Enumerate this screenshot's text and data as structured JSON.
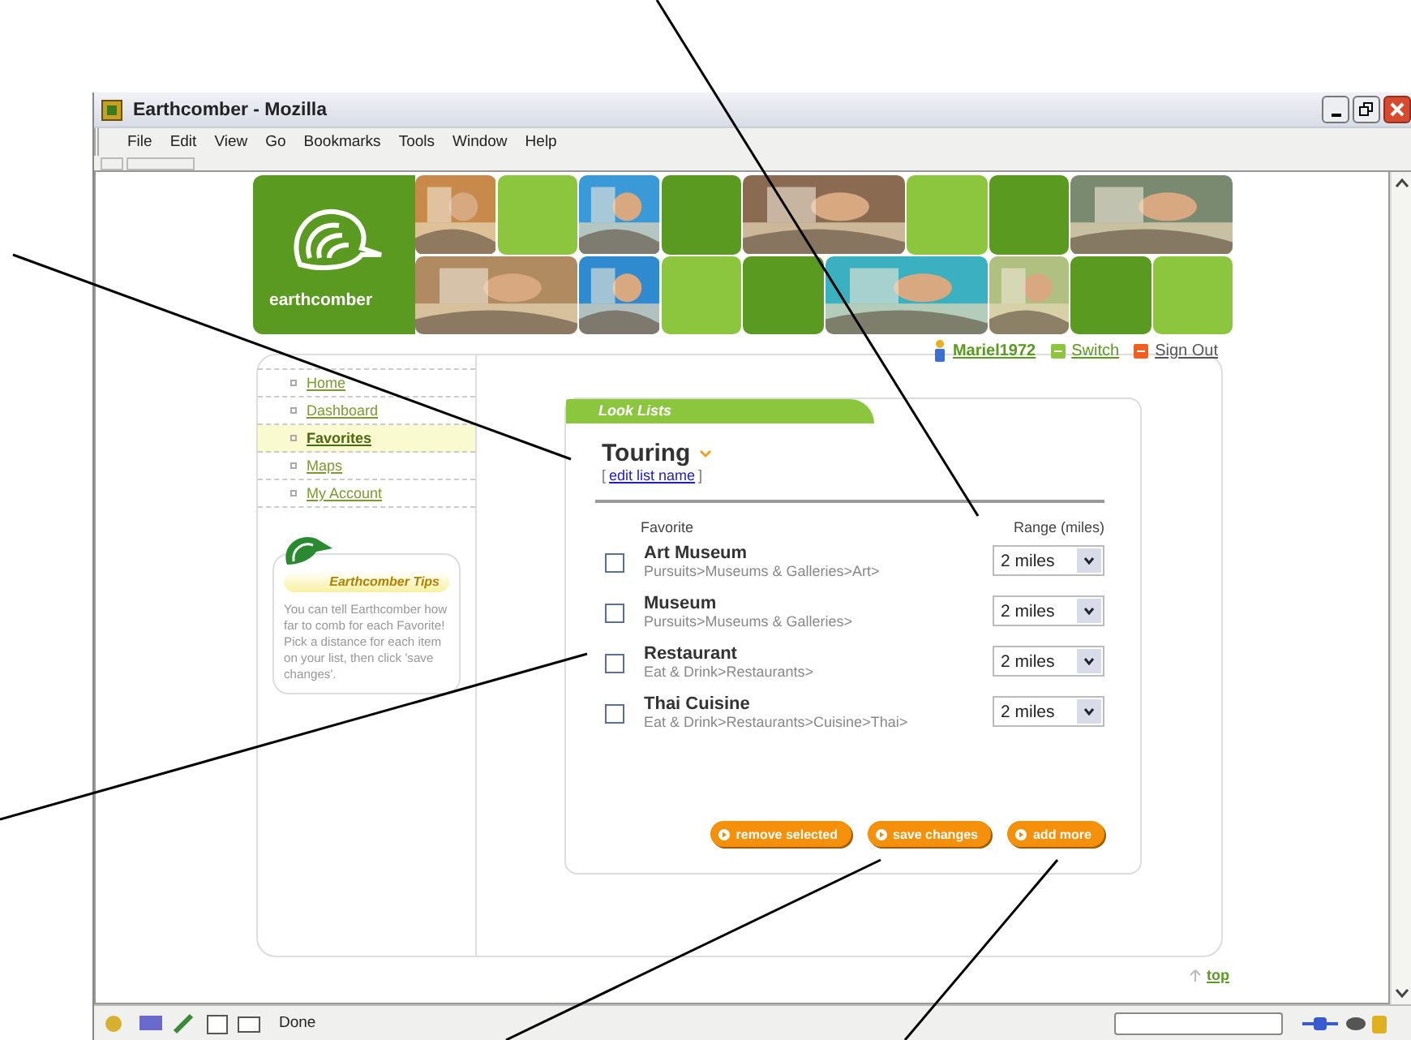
{
  "window": {
    "title": "Earthcomber - Mozilla"
  },
  "menu": [
    "File",
    "Edit",
    "View",
    "Go",
    "Bookmarks",
    "Tools",
    "Window",
    "Help"
  ],
  "logo": {
    "text": "earthcomber"
  },
  "user": {
    "name": "Mariel1972",
    "switch": "Switch",
    "sign_out": "Sign Out"
  },
  "nav": [
    {
      "label": "Home",
      "selected": false
    },
    {
      "label": "Dashboard",
      "selected": false
    },
    {
      "label": "Favorites",
      "selected": true
    },
    {
      "label": "Maps",
      "selected": false
    },
    {
      "label": "My Account",
      "selected": false
    }
  ],
  "tips": {
    "title": "Earthcomber Tips",
    "text": "You can tell Earthcomber how far to comb for each Favorite!  Pick a distance for each item on your list, then click 'save changes'."
  },
  "list": {
    "tab": "Look Lists",
    "title": "Touring",
    "bracket_open": "[",
    "edit_link": "edit list name",
    "bracket_close": "]",
    "columns": [
      "Favorite",
      "Range (miles)"
    ],
    "items": [
      {
        "name": "Art Museum",
        "path": "Pursuits>Museums & Galleries>Art>",
        "checked": false,
        "range": "2 miles"
      },
      {
        "name": "Museum",
        "path": "Pursuits>Museums & Galleries>",
        "checked": false,
        "range": "2 miles"
      },
      {
        "name": "Restaurant",
        "path": "Eat & Drink>Restaurants>",
        "checked": false,
        "range": "2 miles"
      },
      {
        "name": "Thai Cuisine",
        "path": "Eat & Drink>Restaurants>Cuisine>Thai>",
        "checked": false,
        "range": "2 miles"
      }
    ]
  },
  "buttons": [
    "remove selected",
    "save changes",
    "add more"
  ],
  "top_link": "top",
  "status": {
    "text": "Done"
  }
}
